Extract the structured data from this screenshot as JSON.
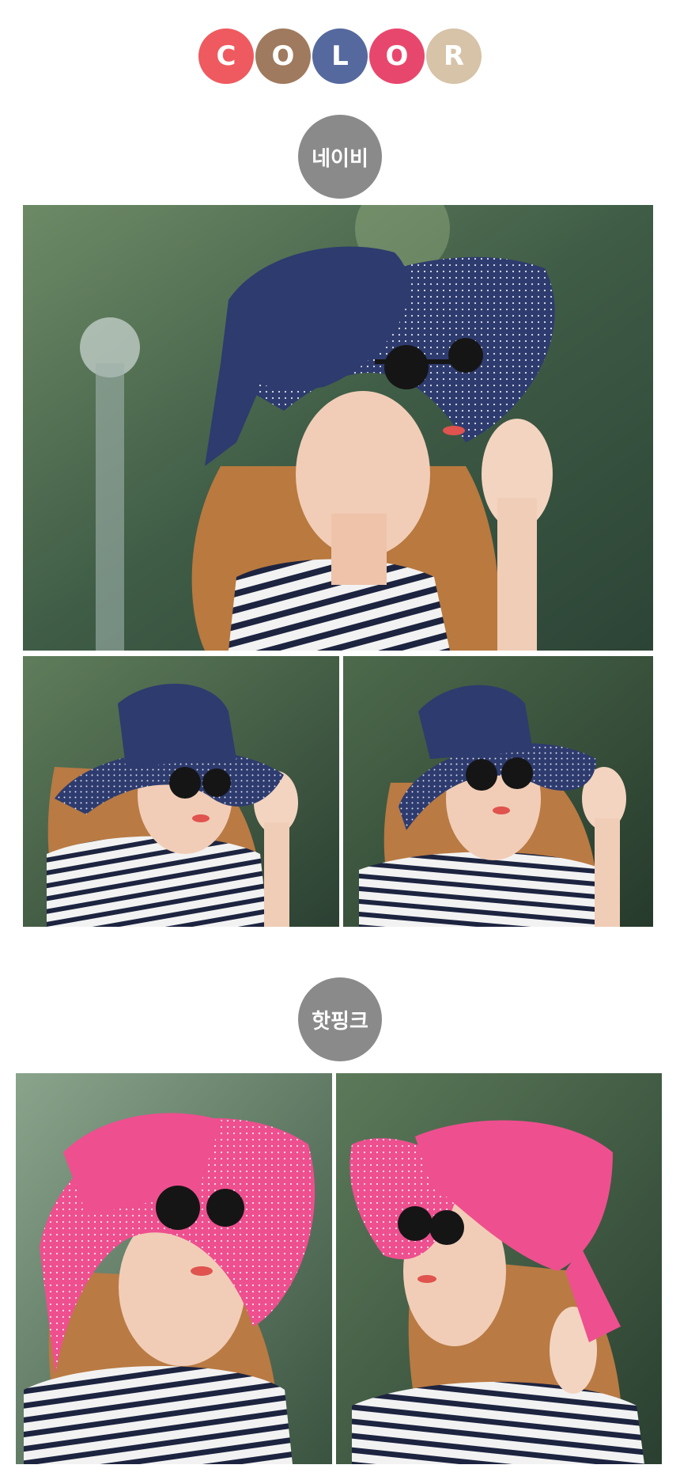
{
  "color_header": {
    "letters": [
      "C",
      "O",
      "L",
      "O",
      "R"
    ],
    "colors": [
      "#ee5a5f",
      "#a07a5e",
      "#55699f",
      "#e8476d",
      "#d6c3a8"
    ]
  },
  "navy": {
    "label": "네이비",
    "hat_color": "#2e3b6e",
    "photos": [
      "main-photo",
      "left-photo",
      "right-photo"
    ]
  },
  "pink": {
    "label": "핫핑크",
    "hat_color": "#ee4f8f",
    "photos": [
      "left-photo",
      "right-photo"
    ]
  }
}
